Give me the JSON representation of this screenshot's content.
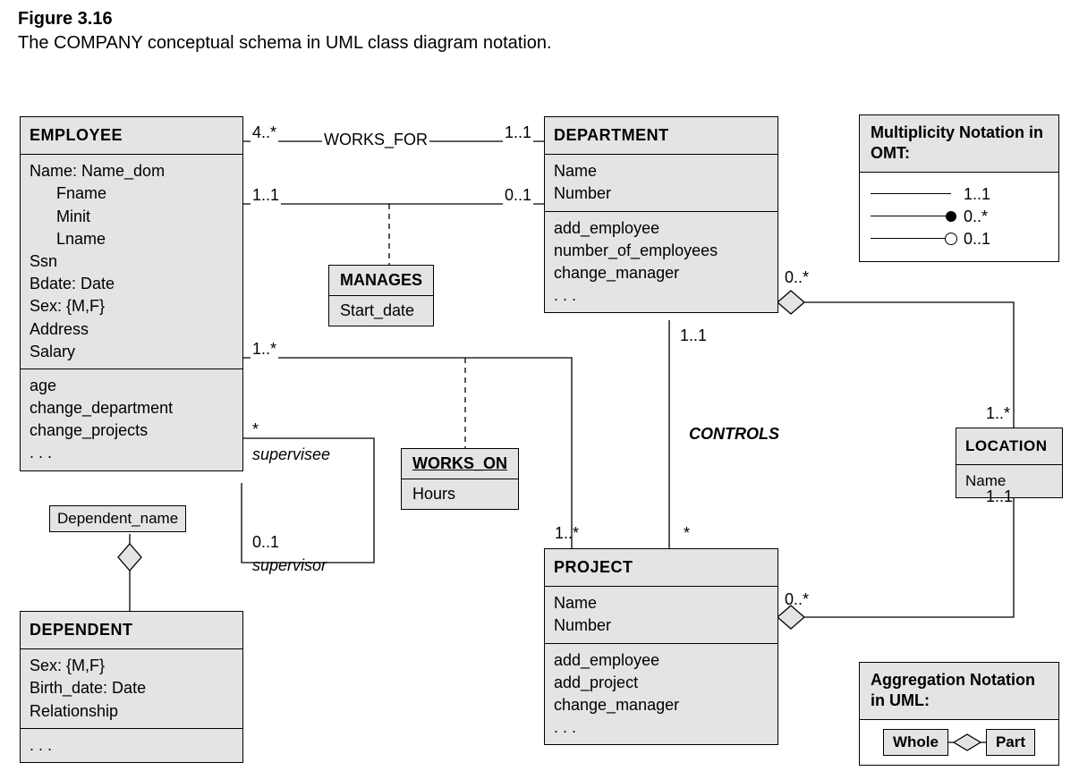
{
  "figure": {
    "number": "Figure 3.16",
    "caption": "The COMPANY conceptual schema in UML class diagram notation."
  },
  "classes": {
    "employee": {
      "title": "EMPLOYEE",
      "attrs": [
        "Name: Name_dom",
        "Fname",
        "Minit",
        "Lname",
        "Ssn",
        "Bdate: Date",
        "Sex: {M,F}",
        "Address",
        "Salary"
      ],
      "ops": [
        "age",
        "change_department",
        "change_projects",
        ". . ."
      ]
    },
    "department": {
      "title": "DEPARTMENT",
      "attrs": [
        "Name",
        "Number"
      ],
      "ops": [
        "add_employee",
        "number_of_employees",
        "change_manager",
        ". . ."
      ]
    },
    "project": {
      "title": "PROJECT",
      "attrs": [
        "Name",
        "Number"
      ],
      "ops": [
        "add_employee",
        "add_project",
        "change_manager",
        ". . ."
      ]
    },
    "dependent": {
      "title": "DEPENDENT",
      "attrs": [
        "Sex: {M,F}",
        "Birth_date: Date",
        "Relationship"
      ],
      "ops": [
        ". . ."
      ]
    },
    "location": {
      "title": "LOCATION",
      "attrs": [
        "Name"
      ]
    }
  },
  "assoc_classes": {
    "manages": {
      "title": "MANAGES",
      "attr": "Start_date"
    },
    "works_on": {
      "title": "WORKS_ON",
      "attr": "Hours"
    }
  },
  "qualifier": {
    "employee_dependent": "Dependent_name"
  },
  "associations": {
    "works_for": {
      "name": "WORKS_FOR",
      "emp_mult": "4..*",
      "dept_mult": "1..1"
    },
    "manages": {
      "emp_mult": "1..1",
      "dept_mult": "0..1"
    },
    "supervision": {
      "supervisee_mult": "*",
      "supervisee_role": "supervisee",
      "supervisor_mult": "0..1",
      "supervisor_role": "supervisor"
    },
    "works_on": {
      "emp_mult": "1..*",
      "proj_mult": "*"
    },
    "controls": {
      "name": "CONTROLS",
      "dept_mult": "1..1",
      "proj_mult": "1..*"
    },
    "dept_location": {
      "dept_mult": "0..*",
      "loc_mult": "1..*"
    },
    "proj_location": {
      "proj_mult": "0..*",
      "loc_mult": "1..1"
    }
  },
  "legend": {
    "omt": {
      "title": "Multiplicity Notation in OMT:",
      "rows": [
        "1..1",
        "0..*",
        "0..1"
      ]
    },
    "agg": {
      "title": "Aggregation Notation in UML:",
      "whole": "Whole",
      "part": "Part"
    }
  }
}
